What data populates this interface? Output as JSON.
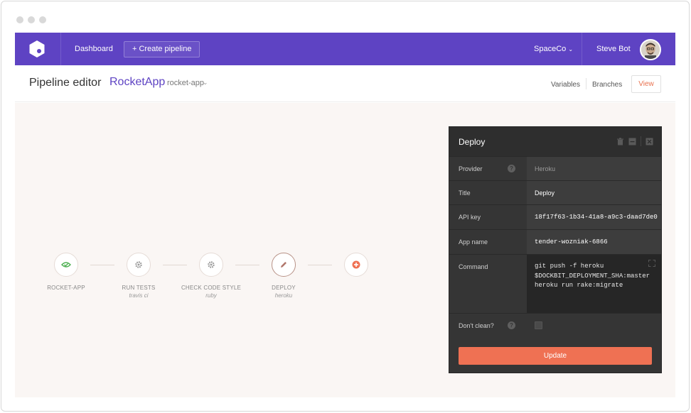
{
  "nav": {
    "dashboard": "Dashboard",
    "create_pipeline": "+ Create pipeline",
    "org": "SpaceCo",
    "user": "Steve Bot"
  },
  "header": {
    "page_title": "Pipeline editor",
    "app_name": "RocketApp",
    "app_slug": "rocket-app",
    "variables": "Variables",
    "branches": "Branches",
    "view": "View"
  },
  "pipeline": {
    "nodes": [
      {
        "label": "ROCKET-APP",
        "sub": "",
        "icon": "eye-icon"
      },
      {
        "label": "RUN TESTS",
        "sub": "travis ci",
        "icon": "gear-icon"
      },
      {
        "label": "CHECK CODE STYLE",
        "sub": "ruby",
        "icon": "gear-icon"
      },
      {
        "label": "DEPLOY",
        "sub": "heroku",
        "icon": "pencil-icon"
      },
      {
        "label": "",
        "sub": "",
        "icon": "plus-circle-icon"
      }
    ]
  },
  "panel": {
    "title": "Deploy",
    "rows": {
      "provider": {
        "label": "Provider",
        "value": "Heroku"
      },
      "title": {
        "label": "Title",
        "value": "Deploy"
      },
      "api_key": {
        "label": "API key",
        "value": "18f17f63-1b34-41a8-a9c3-daad7de0"
      },
      "app_name": {
        "label": "App name",
        "value": "tender-wozniak-6866"
      },
      "command": {
        "label": "Command",
        "value": "git push -f heroku\n$DOCKBIT_DEPLOYMENT_SHA:master\nheroku run rake:migrate"
      },
      "dont_clean": {
        "label": "Don't clean?"
      }
    },
    "update": "Update"
  },
  "colors": {
    "brand": "#5e43c3",
    "accent": "#ef7153",
    "panel": "#353535",
    "green": "#4caf50"
  }
}
